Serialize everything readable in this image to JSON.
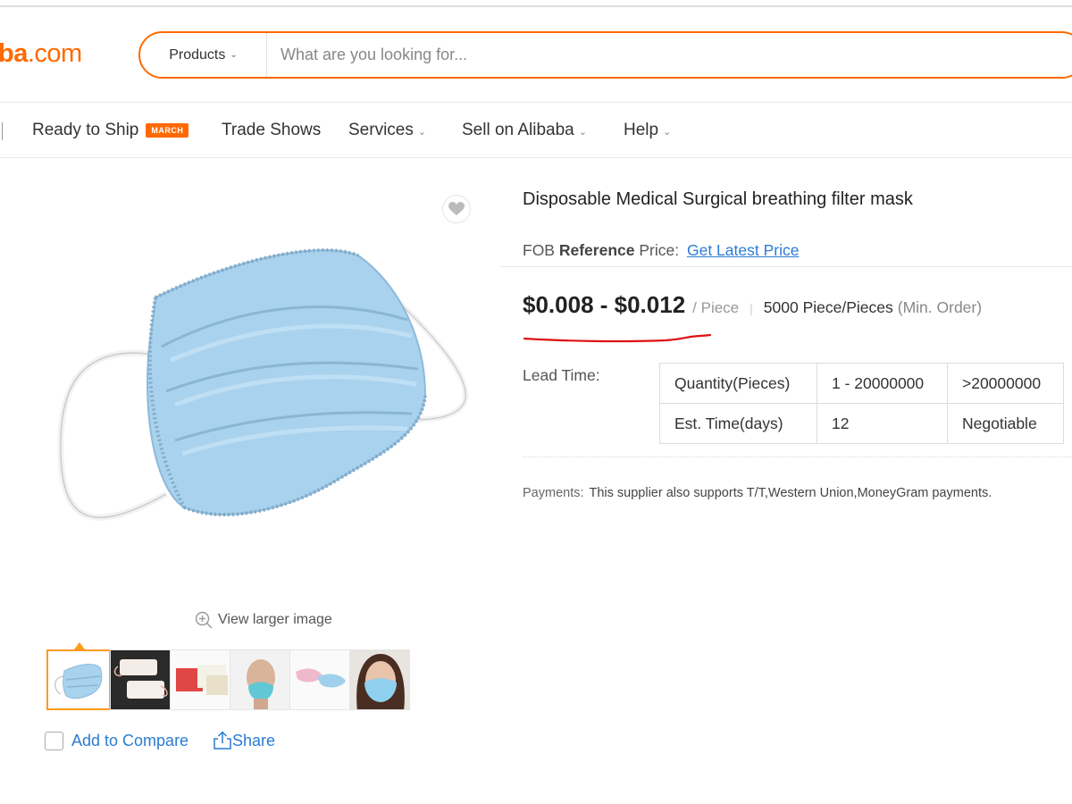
{
  "header": {
    "logo_text": "ba",
    "logo_suffix": ".com",
    "search": {
      "category": "Products",
      "placeholder": "What are you looking for..."
    }
  },
  "nav": {
    "items": [
      {
        "label": "Ready to Ship",
        "badge": "MARCH"
      },
      {
        "label": "Trade Shows"
      },
      {
        "label": "Services"
      },
      {
        "label": "Sell on Alibaba"
      },
      {
        "label": "Help"
      }
    ]
  },
  "gallery": {
    "view_larger": "View larger image",
    "thumbnails": [
      "blue mask",
      "white masks",
      "colored masks",
      "mannequin with mask",
      "pink and blue masks",
      "woman with mask"
    ],
    "add_to_compare": "Add to Compare",
    "share": "Share"
  },
  "product": {
    "title": "Disposable Medical Surgical breathing filter mask",
    "fob_prefix": "FOB",
    "fob_bold": "Reference",
    "fob_suffix": "Price:",
    "get_latest_price": "Get Latest Price",
    "price": "$0.008 - $0.012",
    "unit": "/ Piece",
    "separator": "|",
    "moq": "5000 Piece/Pieces",
    "moq_note": "(Min. Order)",
    "lead_time_label": "Lead Time:",
    "lead_table": {
      "rows": [
        [
          "Quantity(Pieces)",
          "1 - 20000000",
          ">20000000"
        ],
        [
          "Est. Time(days)",
          "12",
          "Negotiable"
        ]
      ]
    },
    "payments_label": "Payments:",
    "payments_text": "This supplier also supports T/T,Western Union,MoneyGram payments."
  },
  "colors": {
    "brand": "#ff6a00",
    "link": "#2b7cd3",
    "annotation": "#dd1111",
    "mask": "#a9d2ee"
  }
}
